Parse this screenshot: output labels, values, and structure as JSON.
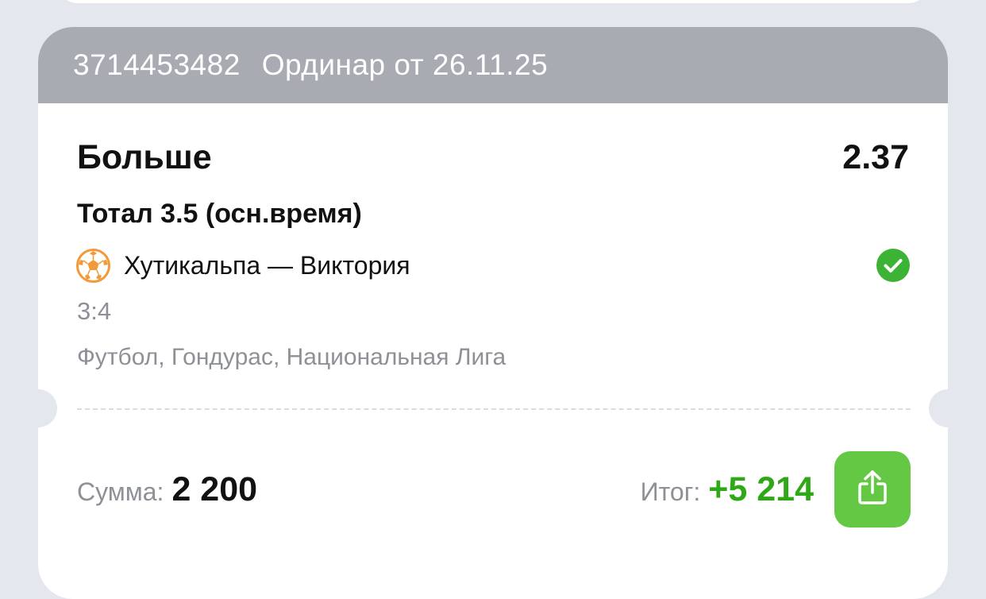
{
  "ticket": {
    "bet_id": "3714453482",
    "bet_type_date": "Ординар от 26.11.25",
    "outcome": "Больше",
    "odds": "2.37",
    "market": "Тотал 3.5 (осн.время)",
    "sport_icon": "soccer-ball-icon",
    "event": "Хутикальпа — Виктория",
    "status_icon": "check-circle-icon",
    "score": "3:4",
    "league": "Футбол, Гондурас, Национальная Лига"
  },
  "footer": {
    "sum_label": "Сумма:",
    "sum_value": "2 200",
    "total_label": "Итог:",
    "total_value": "+5 214",
    "share_icon": "share-icon"
  },
  "colors": {
    "header_bg": "#a8abb2",
    "win_green": "#2fa816",
    "button_green": "#64c845",
    "check_green": "#3db335",
    "ball_orange": "#f29a3a"
  }
}
